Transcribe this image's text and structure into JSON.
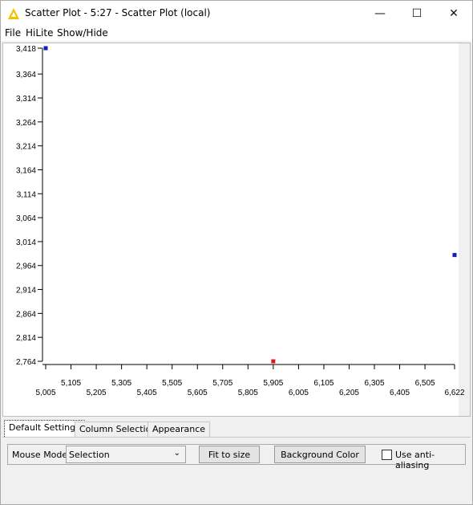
{
  "window": {
    "title": "Scatter Plot - 5:27 - Scatter Plot (local)",
    "minimize_glyph": "—",
    "maximize_glyph": "☐",
    "close_glyph": "✕"
  },
  "menu": {
    "file": "File",
    "hilite": "HiLite",
    "show_hide": "Show/Hide"
  },
  "chart_data": {
    "type": "scatter",
    "xlim": [
      5.005,
      6.622
    ],
    "ylim": [
      2.764,
      3.418
    ],
    "x_ticks_upper": [
      "5,105",
      "5,305",
      "5,505",
      "5,705",
      "5,905",
      "6,105",
      "6,305",
      "6,505"
    ],
    "x_ticks_lower": [
      "5,005",
      "5,205",
      "5,405",
      "5,605",
      "5,805",
      "6,005",
      "6,205",
      "6,405",
      "6,622"
    ],
    "x_tick_values": [
      5.005,
      5.105,
      5.205,
      5.305,
      5.405,
      5.505,
      5.605,
      5.705,
      5.805,
      5.905,
      6.005,
      6.105,
      6.205,
      6.305,
      6.405,
      6.505,
      6.622
    ],
    "y_ticks": [
      "3,418",
      "3,364",
      "3,314",
      "3,264",
      "3,214",
      "3,164",
      "3,114",
      "3,064",
      "3,014",
      "2,964",
      "2,914",
      "2,864",
      "2,814",
      "2,764"
    ],
    "y_tick_values": [
      3.418,
      3.364,
      3.314,
      3.264,
      3.214,
      3.164,
      3.114,
      3.064,
      3.014,
      2.964,
      2.914,
      2.864,
      2.814,
      2.764
    ],
    "points": [
      {
        "x": 5.005,
        "y": 3.418,
        "color": "#1a1ab8"
      },
      {
        "x": 5.905,
        "y": 2.764,
        "color": "#d81a1a"
      },
      {
        "x": 6.622,
        "y": 2.986,
        "color": "#1a1ab8"
      }
    ],
    "grid": false
  },
  "tabs": [
    {
      "label": "Default Settings",
      "active": true
    },
    {
      "label": "Column Selection",
      "active": false
    },
    {
      "label": "Appearance",
      "active": false
    }
  ],
  "settings": {
    "mouse_mode_label": "Mouse Mode",
    "mouse_mode_value": "Selection",
    "fit_button": "Fit to size",
    "background_button": "Background Color",
    "anti_alias_label": "Use anti-aliasing",
    "anti_alias_checked": false
  },
  "colors": {
    "point_blue": "#1a1ab8",
    "point_red": "#d81a1a",
    "icon_yellow": "#f2c200"
  }
}
